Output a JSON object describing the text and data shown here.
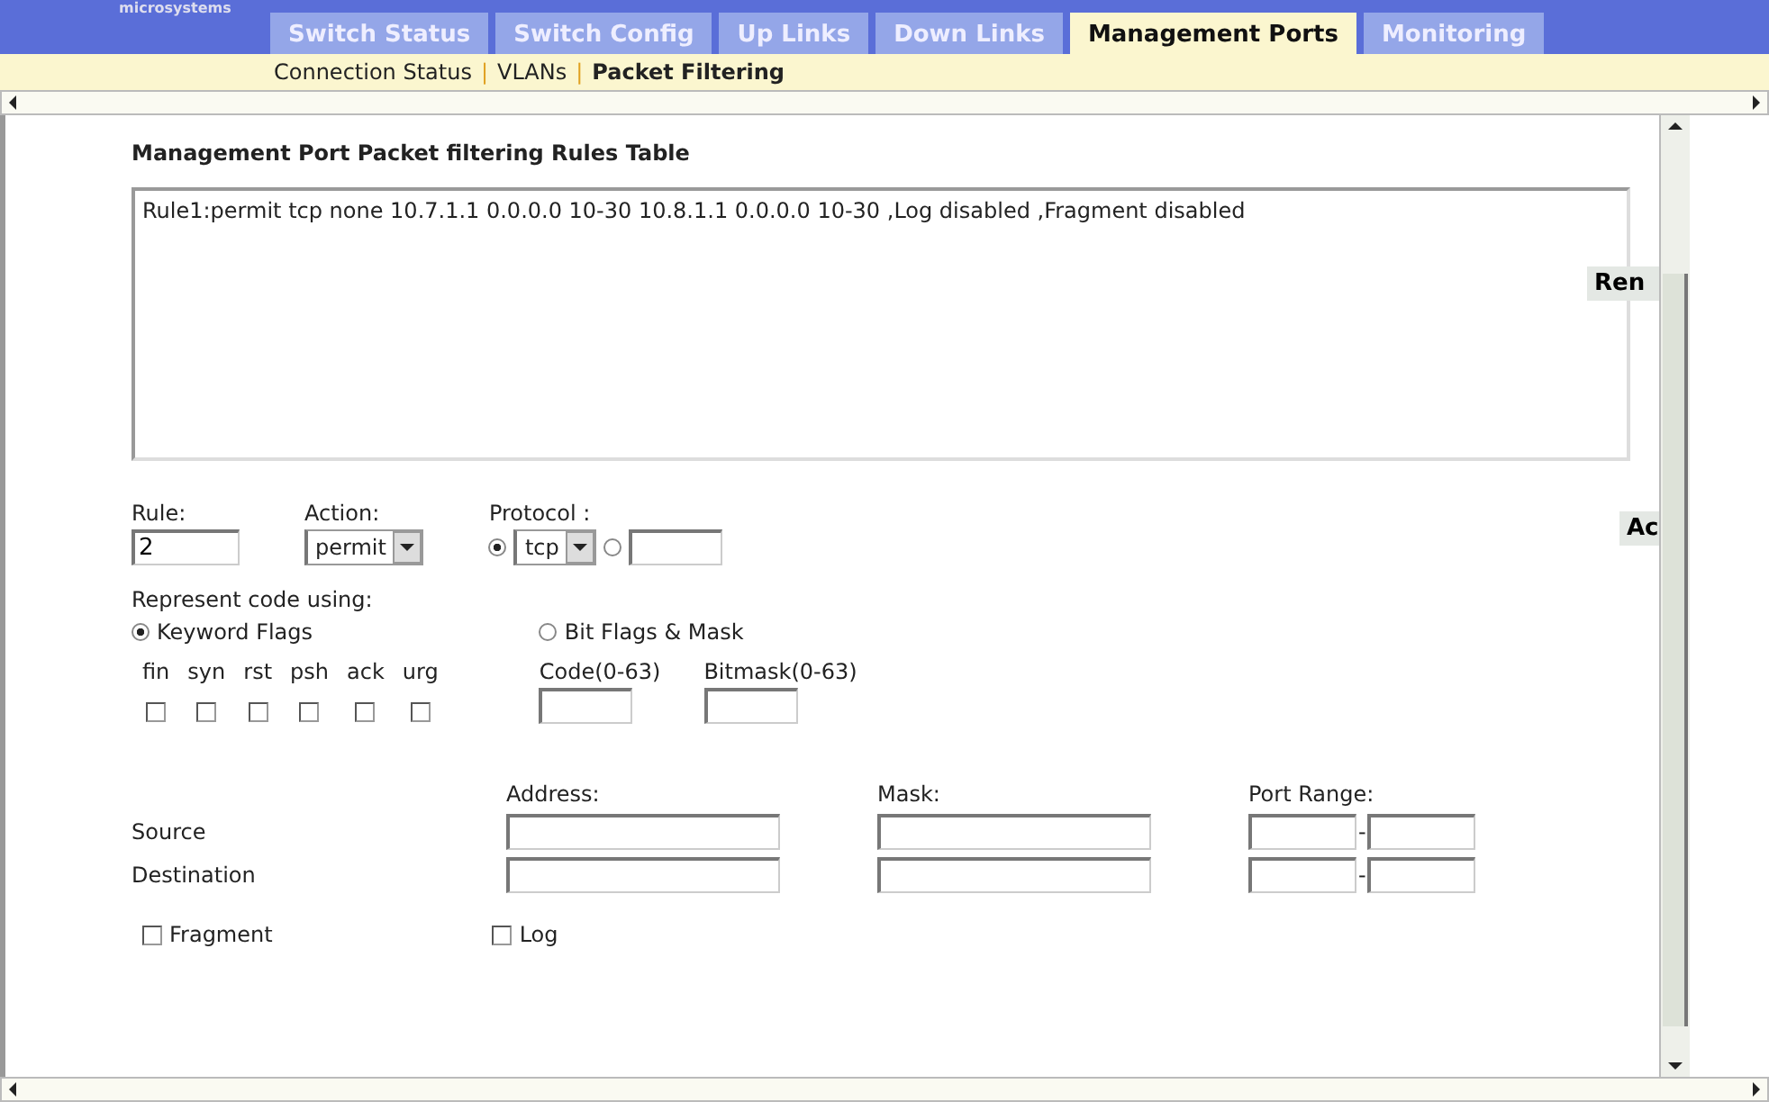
{
  "brand": {
    "text": "microsystems"
  },
  "tabs": [
    {
      "label": "Switch Status",
      "selected": false
    },
    {
      "label": "Switch Config",
      "selected": false
    },
    {
      "label": "Up Links",
      "selected": false
    },
    {
      "label": "Down Links",
      "selected": false
    },
    {
      "label": "Management Ports",
      "selected": true
    },
    {
      "label": "Monitoring",
      "selected": false
    }
  ],
  "subnav": [
    {
      "label": "Connection Status",
      "selected": false
    },
    {
      "label": "VLANs",
      "selected": false
    },
    {
      "label": "Packet Filtering",
      "selected": true
    }
  ],
  "subnav_separator": "|",
  "table": {
    "title": "Management Port Packet filtering Rules Table",
    "rules": [
      "Rule1:permit tcp none 10.7.1.1 0.0.0.0 10-30 10.8.1.1 0.0.0.0 10-30 ,Log disabled ,Fragment disabled"
    ]
  },
  "side_buttons": [
    "Ren",
    "Ac"
  ],
  "rule": {
    "label": "Rule:",
    "value": "2"
  },
  "action": {
    "label": "Action:",
    "value": "permit"
  },
  "protocol": {
    "label": "Protocol :",
    "options": [
      {
        "kind": "select",
        "selected": true,
        "value": "tcp"
      },
      {
        "kind": "input",
        "selected": false
      }
    ]
  },
  "represent": {
    "label": "Represent code using:",
    "options": [
      {
        "label": "Keyword Flags",
        "selected": true
      },
      {
        "label": "Bit Flags & Mask",
        "selected": false
      }
    ]
  },
  "flags": [
    {
      "label": "fin",
      "checked": false
    },
    {
      "label": "syn",
      "checked": false
    },
    {
      "label": "rst",
      "checked": false
    },
    {
      "label": "psh",
      "checked": false
    },
    {
      "label": "ack",
      "checked": false
    },
    {
      "label": "urg",
      "checked": false
    }
  ],
  "code": {
    "label": "Code(0-63)"
  },
  "bitmask": {
    "label": "Bitmask(0-63)"
  },
  "address_columns": [
    "Address:",
    "Mask:",
    "Port Range:"
  ],
  "address_rows": [
    "Source",
    "Destination"
  ],
  "range_separator": "-",
  "options": [
    {
      "label": "Fragment",
      "checked": false
    },
    {
      "label": "Log",
      "checked": false
    }
  ]
}
